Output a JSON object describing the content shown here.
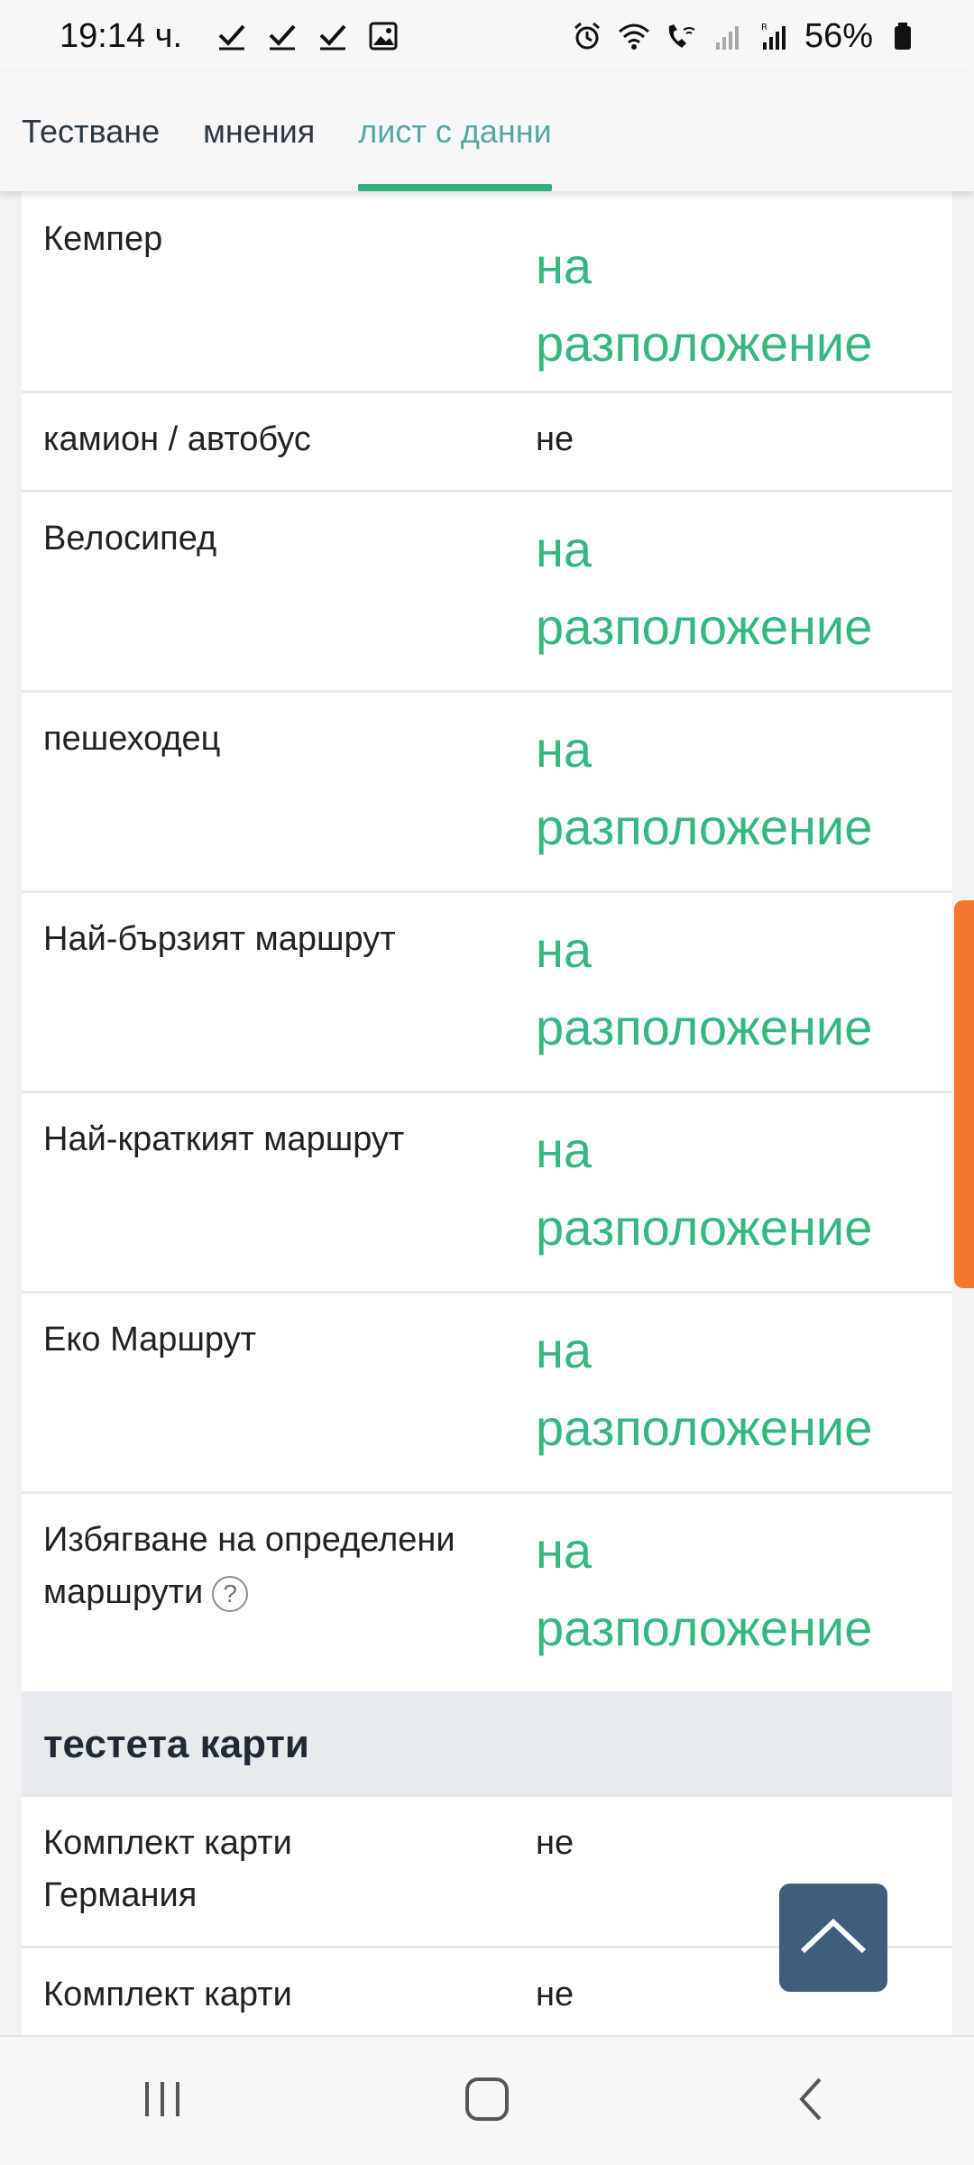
{
  "status_bar": {
    "time": "19:14 ч.",
    "battery": "56%",
    "left_icons": [
      "check-icon",
      "check-icon",
      "check-icon",
      "image-icon"
    ],
    "right_icons": [
      "alarm-icon",
      "wifi-icon",
      "wifi-call-icon",
      "signal-icon",
      "signal-roaming-icon",
      "battery-icon"
    ]
  },
  "tabs": [
    {
      "label": "Тестване",
      "active": false
    },
    {
      "label": "мнения",
      "active": false
    },
    {
      "label": "лист с данни",
      "active": true
    }
  ],
  "rows": [
    {
      "label": "Кемпер",
      "value": "на разположение",
      "available": true
    },
    {
      "label": "камион / автобус",
      "value": "не",
      "available": false
    },
    {
      "label": "Велосипед",
      "value": "на разположение",
      "available": true
    },
    {
      "label": "пешеходец",
      "value": "на разположение",
      "available": true
    },
    {
      "label": "Най-бързият маршрут",
      "value": "на разположение",
      "available": true
    },
    {
      "label": "Най-краткият маршрут",
      "value": "на разположение",
      "available": true
    },
    {
      "label": "Еко Маршрут",
      "value": "на разположение",
      "available": true
    },
    {
      "label": "Избягване на определени маршрути",
      "help_icon": "?",
      "value": "на разположение",
      "available": true
    }
  ],
  "section": {
    "title": "тестета карти"
  },
  "map_rows": [
    {
      "label": "Комплект карти Германия",
      "value": "не"
    },
    {
      "label": "Комплект карти",
      "value": "не"
    }
  ],
  "colors": {
    "available_green": "#35b880",
    "tab_active": "#2fb37b",
    "scroll_button": "#3f5d7d",
    "side_tab": "#f3782d"
  }
}
